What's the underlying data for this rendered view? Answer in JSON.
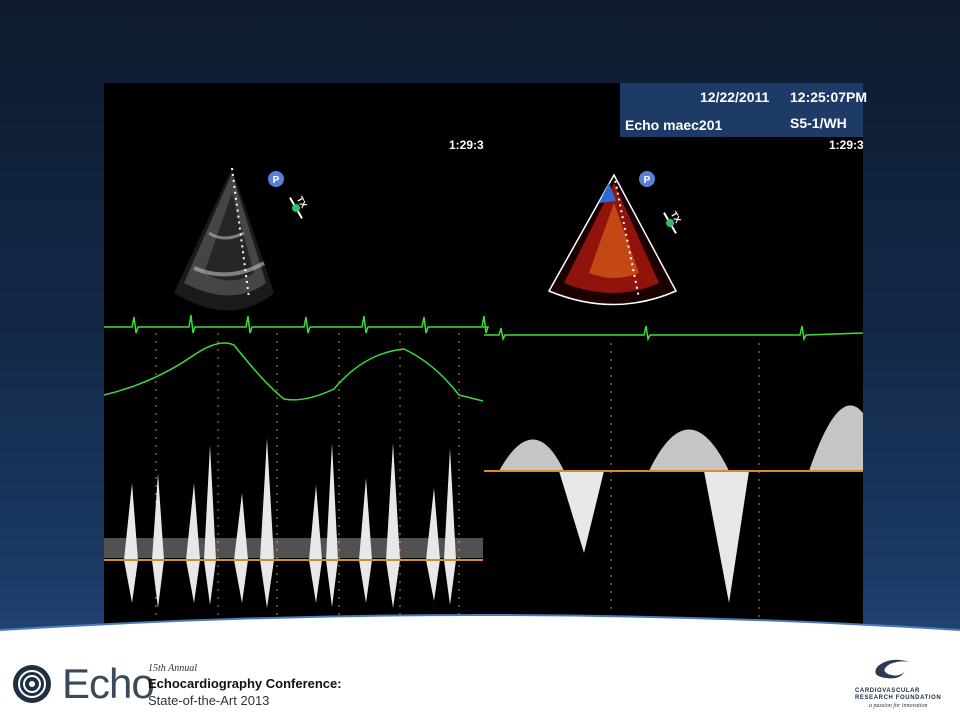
{
  "info_box": {
    "date": "12/22/2011",
    "time": "12:25:07PM",
    "study": "Echo maec201",
    "probe": "S5-1/WH"
  },
  "left_image": {
    "clock": "1:29:3",
    "marker_label": "P",
    "tx_label": "TX"
  },
  "right_image": {
    "clock": "1:29:3",
    "marker_label": "P",
    "tx_label": "TX"
  },
  "footer": {
    "logo_word": "Echo",
    "annual": "15th Annual",
    "conference_title": "Echocardiography Conference:",
    "conference_subtitle": "State-of-the-Art 2013",
    "foundation_line1": "CARDIOVASCULAR",
    "foundation_line2": "RESEARCH FOUNDATION",
    "foundation_tagline": "a passion for innovation"
  },
  "colors": {
    "background": "#132847",
    "ecg": "#3ddc3d",
    "baseline": "#d98a2a",
    "doppler": "#e8e8e8",
    "info_box": "#1e3a66"
  }
}
